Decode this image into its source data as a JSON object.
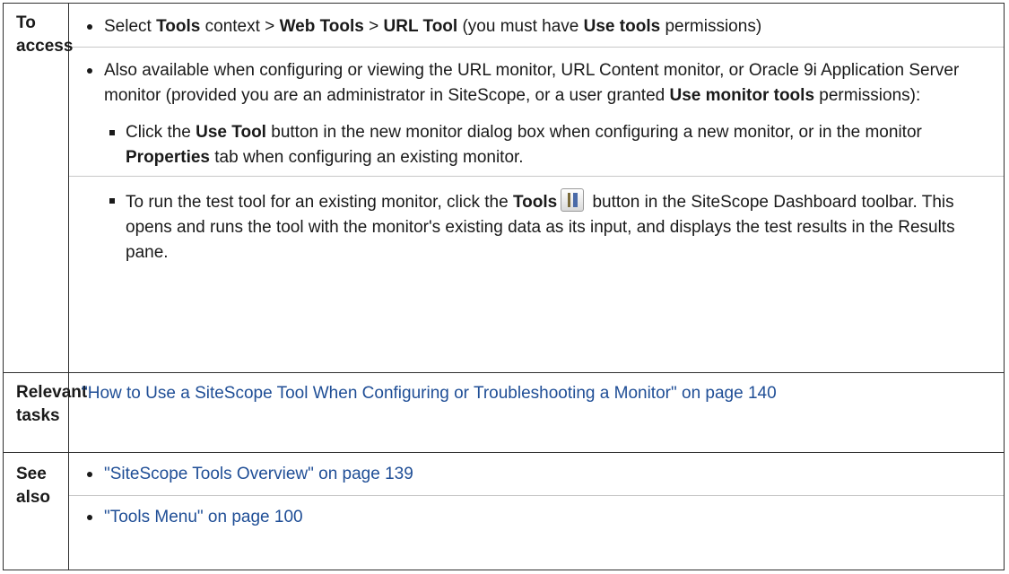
{
  "rows": [
    {
      "heading": "To access"
    },
    {
      "heading": "Relevant tasks"
    },
    {
      "heading": "See also"
    }
  ],
  "access": {
    "b1": {
      "t1": "Select ",
      "b_tools": "Tools",
      "t2": " context > ",
      "b_web": "Web Tools",
      "t3": " > ",
      "b_url": "URL Tool",
      "t4": " (you must have ",
      "b_use": "Use tools",
      "t5": " permissions)"
    },
    "b2": {
      "t1": "Also available when configuring or viewing the URL monitor, URL Content monitor, or Oracle 9i Application Server monitor (provided you are an administrator in SiteScope, or a user granted ",
      "b1": "Use monitor tools",
      "t2": " permissions):"
    },
    "s1": {
      "t1": "Click the ",
      "b1": "Use Tool",
      "t2": " button in the new monitor dialog box when configuring a new monitor, or in the monitor ",
      "b2": "Properties",
      "t3": " tab when configuring an existing monitor."
    },
    "s2": {
      "t1": "To run the test tool for an existing monitor, click the ",
      "b1": "Tools",
      "icon": "tools-icon",
      "t2": " button in the SiteScope Dashboard toolbar. This opens and runs the tool with the monitor's existing data as its input, and displays the test results in the Results pane."
    }
  },
  "tasks": {
    "link": "\"How to Use a SiteScope Tool When Configuring or Troubleshooting a Monitor\" on page 140"
  },
  "see_also": [
    {
      "link": "\"SiteScope Tools Overview\" on page 139"
    },
    {
      "link": "\"Tools Menu\" on page 100"
    }
  ],
  "colors": {
    "link": "#1f4e96",
    "border": "#2f2f2f",
    "divider": "#c8c8c8"
  }
}
